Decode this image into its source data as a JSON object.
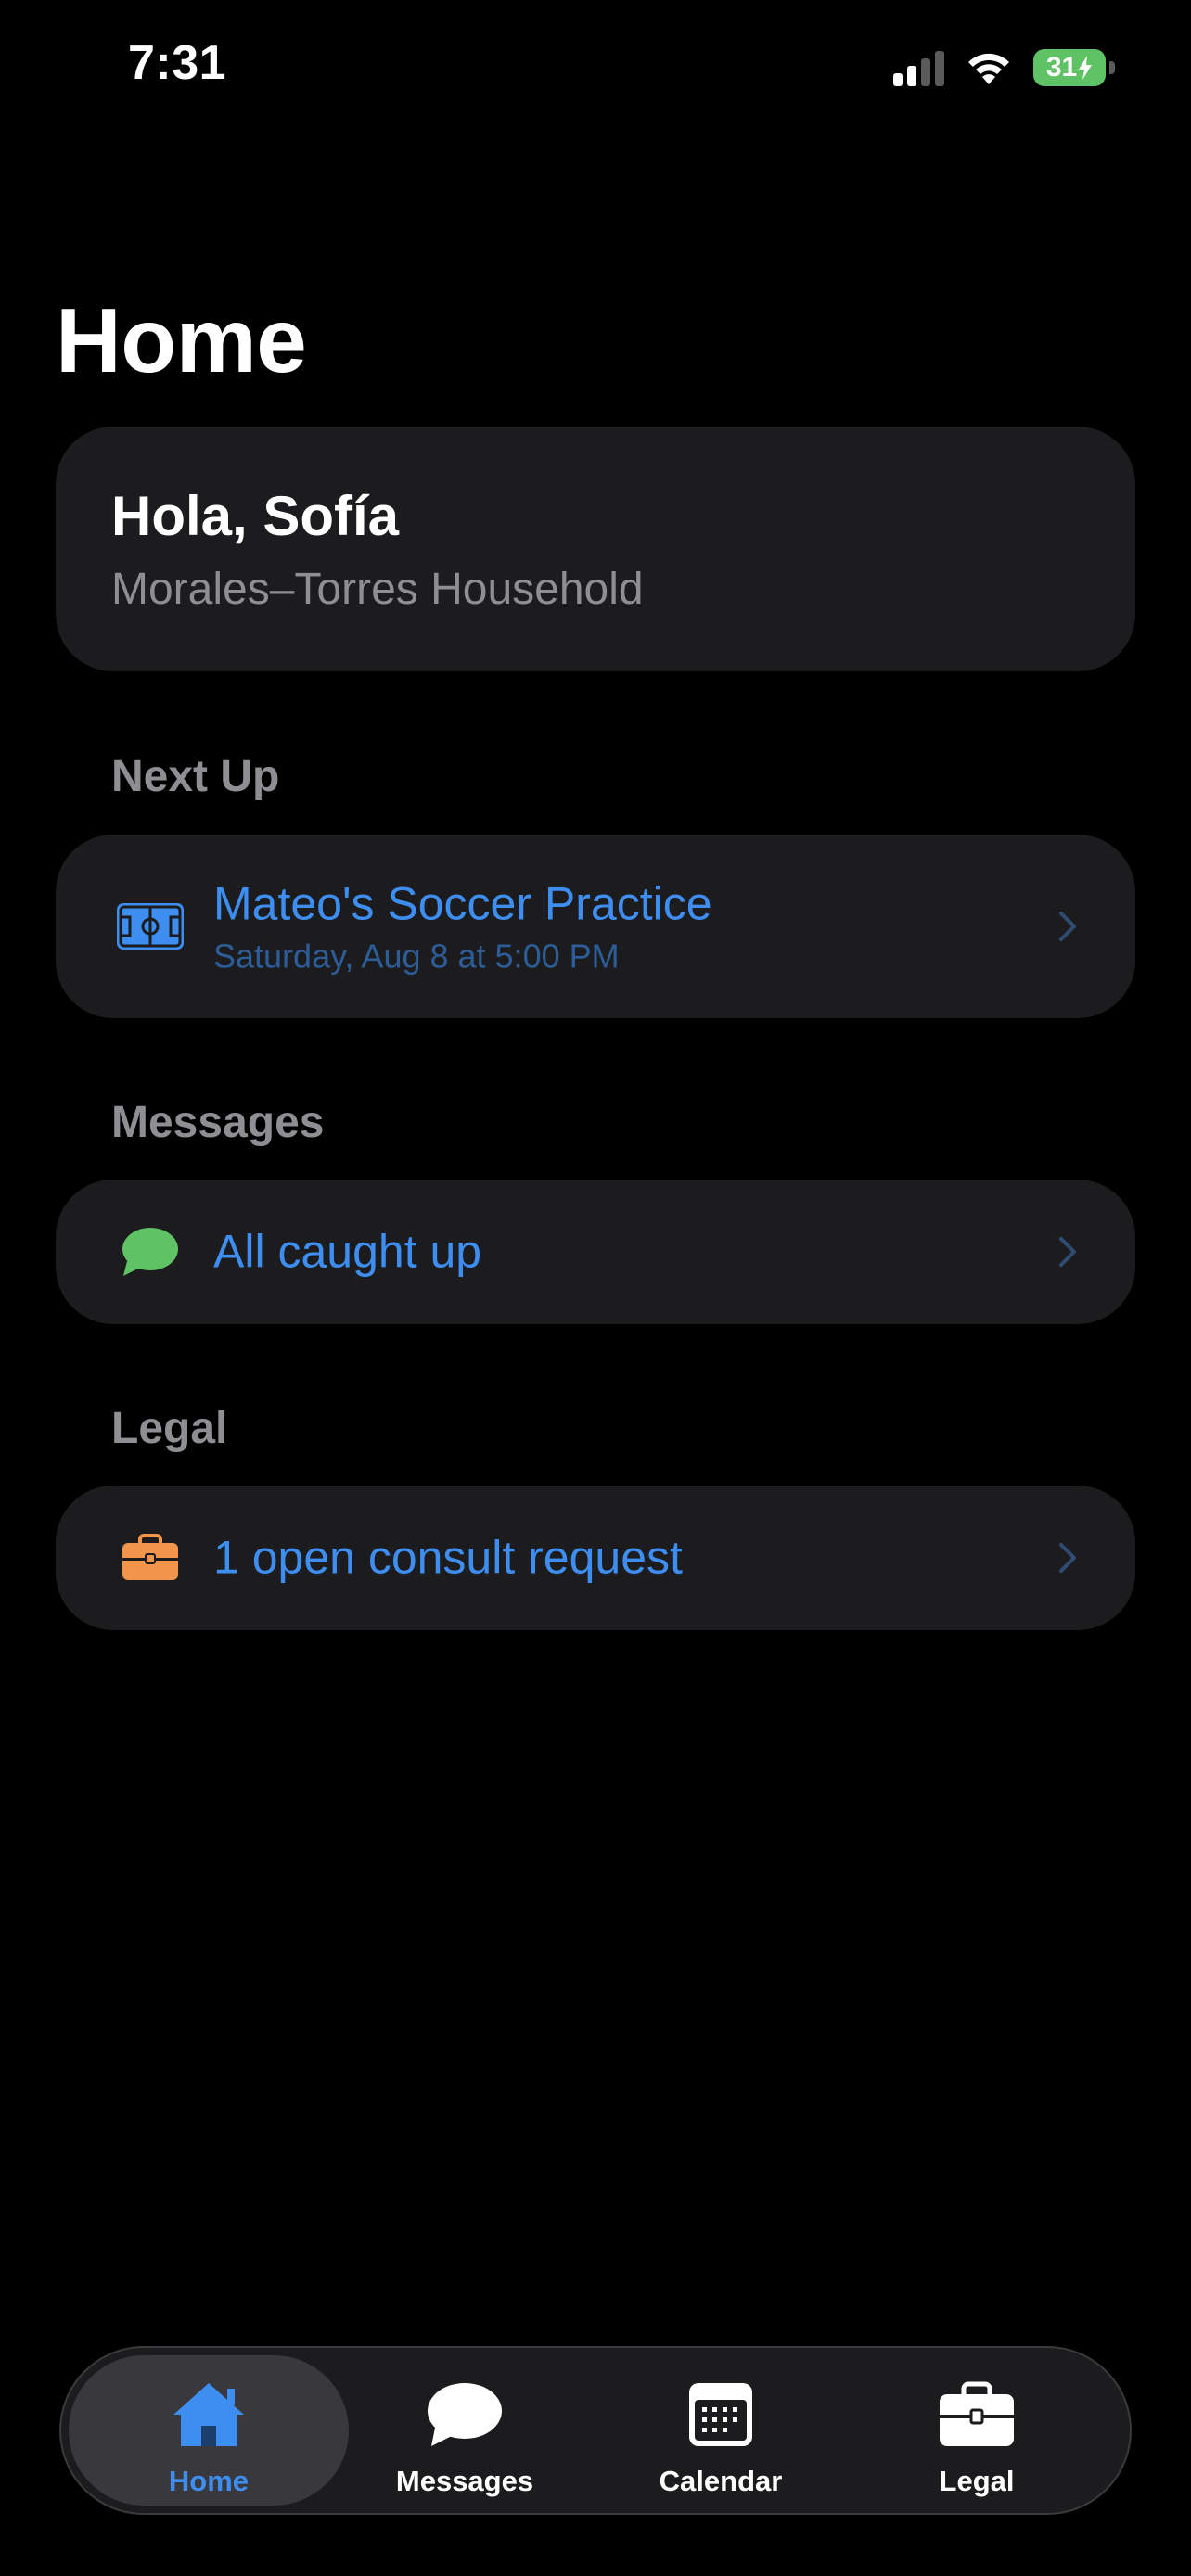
{
  "status_bar": {
    "time": "7:31",
    "battery_percent": "31",
    "battery_color": "#5fc264",
    "signal_bars_active": 2,
    "signal_bars_total": 4,
    "icons": [
      "signal-icon",
      "wifi-icon",
      "battery-charging-icon"
    ]
  },
  "page": {
    "title": "Home"
  },
  "greeting": {
    "title": "Hola, Sofía",
    "subtitle": "Morales–Torres Household"
  },
  "next_up": {
    "header": "Next Up",
    "icon": "soccer-field-icon",
    "title": "Mateo's Soccer Practice",
    "subtitle": "Saturday, Aug 8 at 5:00 PM"
  },
  "messages": {
    "header": "Messages",
    "icon": "chat-bubble-icon",
    "title": "All caught up"
  },
  "legal": {
    "header": "Legal",
    "icon": "briefcase-icon",
    "title": "1 open consult request"
  },
  "tab_bar": {
    "active_tab": "Home",
    "tabs": [
      {
        "label": "Home",
        "icon": "house-icon"
      },
      {
        "label": "Messages",
        "icon": "chat-bubble-icon"
      },
      {
        "label": "Calendar",
        "icon": "calendar-icon"
      },
      {
        "label": "Legal",
        "icon": "briefcase-icon"
      }
    ]
  },
  "colors": {
    "accent": "#3d8ef0",
    "card_background": "#1c1c1e",
    "secondary_text": "#8e8e93",
    "messages_icon": "#5fc264",
    "legal_icon": "#f0954a"
  }
}
